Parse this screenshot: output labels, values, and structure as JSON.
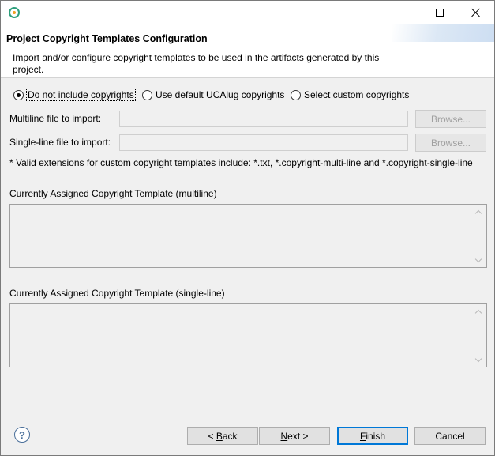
{
  "window": {
    "icon": "app-logo-icon"
  },
  "header": {
    "title": "Project Copyright Templates Configuration",
    "description": "Import and/or configure copyright templates to be used in the artifacts generated by this project."
  },
  "radios": {
    "none_label": "Do not include copyrights",
    "default_label": "Use default UCAlug copyrights",
    "custom_label": "Select custom copyrights",
    "selected": "none"
  },
  "fields": {
    "multiline_label": "Multiline file to import:",
    "multiline_value": "",
    "singleline_label": "Single-line file to import:",
    "singleline_value": "",
    "browse_label": "Browse..."
  },
  "note": "* Valid extensions for custom copyright templates include:   *.txt, *.copyright-multi-line and *.copyright-single-line",
  "sections": {
    "multiline_label": "Currently Assigned Copyright Template (multiline)",
    "singleline_label": "Currently Assigned Copyright Template (single-line)"
  },
  "footer": {
    "back_prefix": "< ",
    "back_mnemonic": "B",
    "back_rest": "ack",
    "next_mnemonic": "N",
    "next_rest": "ext >",
    "finish_mnemonic": "F",
    "finish_rest": "inish",
    "cancel_label": "Cancel",
    "help_glyph": "?"
  }
}
